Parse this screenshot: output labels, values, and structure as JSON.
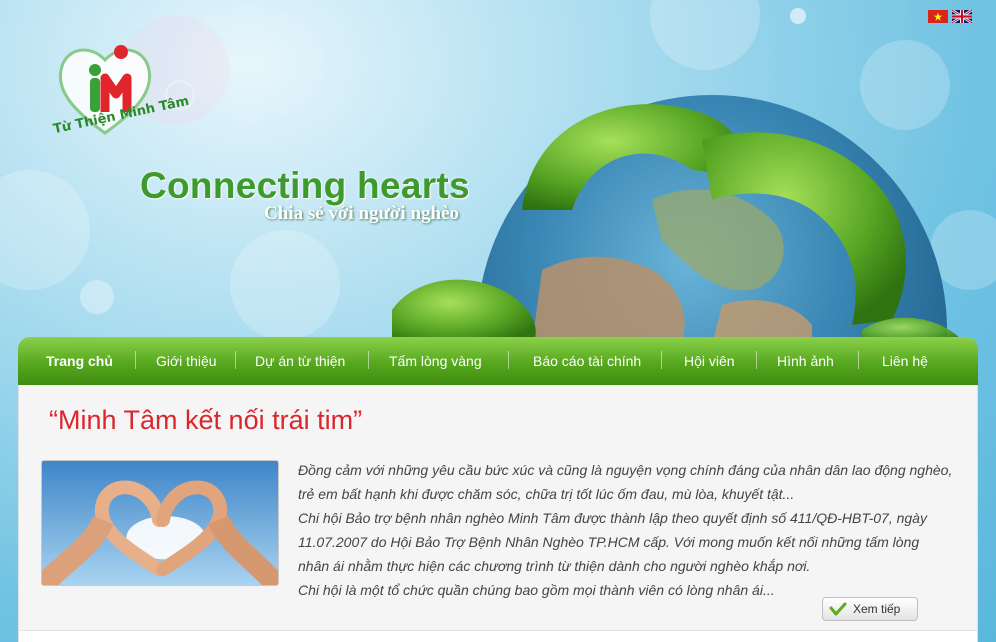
{
  "header": {
    "logo_text": "Từ Thiện Minh Tâm",
    "hero_title": "Connecting hearts",
    "hero_subtitle": "Chia sẻ với người nghèo",
    "flags": [
      "vietnam-flag-icon",
      "uk-flag-icon"
    ]
  },
  "nav": {
    "items": [
      {
        "label": "Trang chủ",
        "active": true
      },
      {
        "label": "Giới thiệu"
      },
      {
        "label": "Dự án từ thiện"
      },
      {
        "label": "Tấm lòng vàng"
      },
      {
        "label": "Báo cáo tài chính"
      },
      {
        "label": "Hội viên"
      },
      {
        "label": "Hình ảnh"
      },
      {
        "label": "Liên hệ"
      }
    ]
  },
  "main": {
    "title": "“Minh Tâm kết nối trái tim”",
    "paragraphs": [
      "Đồng cảm với những yêu cầu bức xúc và cũng là nguyện vọng chính đáng của nhân dân lao động nghèo, trẻ em bất hạnh khi được chăm sóc, chữa trị tốt lúc ốm đau, mù lòa, khuyết tật...",
      "Chi hội Bảo trợ bệnh nhân nghèo Minh Tâm được thành lập theo quyết định số 411/QĐ-HBT-07, ngày 11.07.2007 do Hội Bảo Trợ Bệnh Nhân Nghèo TP.HCM cấp. Với mong muốn kết nối những tấm lòng nhân ái nhằm thực hiện các chương trình từ thiện dành cho người nghèo khắp nơi.",
      "Chi hội là một tổ chức quần chúng bao gồm mọi thành viên có lòng nhân ái..."
    ],
    "more_button": "Xem tiếp"
  },
  "colors": {
    "nav_green": "#56a81e",
    "title_red": "#d9272e",
    "hero_green": "#3d9a2c"
  }
}
